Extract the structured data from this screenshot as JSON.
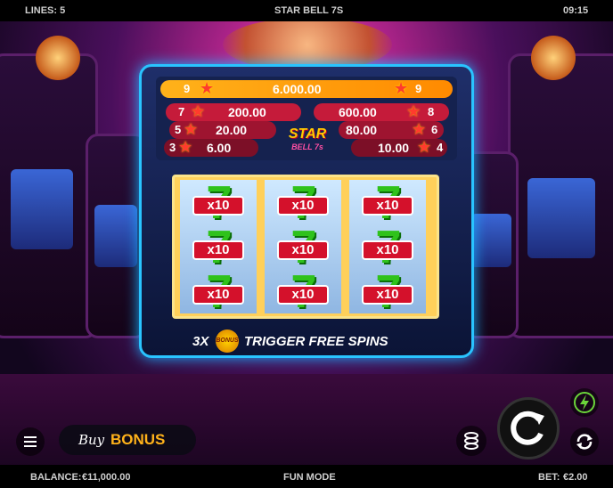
{
  "topbar": {
    "lines": "LINES: 5",
    "title": "STAR BELL 7S",
    "time": "09:15"
  },
  "paytable": {
    "top": {
      "left_count": "9",
      "value": "6.000.00",
      "right_count": "9"
    },
    "rows_left": [
      {
        "count": "7",
        "value": "200.00"
      },
      {
        "count": "5",
        "value": "20.00"
      },
      {
        "count": "3",
        "value": "6.00"
      }
    ],
    "rows_right": [
      {
        "count": "8",
        "value": "600.00"
      },
      {
        "count": "6",
        "value": "80.00"
      },
      {
        "count": "4",
        "value": "10.00"
      }
    ]
  },
  "logo": {
    "line1": "STAR",
    "line2": "BELL 7s"
  },
  "reels": {
    "multiplier": "x10"
  },
  "banner": {
    "count": "3X",
    "bonus_label": "BONUS",
    "text": "TRIGGER FREE SPINS"
  },
  "buy_bonus": {
    "buy": "Buy",
    "bonus": "BONUS"
  },
  "bottombar": {
    "balance_label": "BALANCE:",
    "balance": "€11,000.00",
    "mode": "FUN MODE",
    "bet_label": "BET:",
    "bet": "€2.00"
  },
  "icons": {
    "menu": "menu-icon",
    "stack": "coin-stack-icon",
    "spin": "spin-icon",
    "turbo": "lightning-icon",
    "autoplay": "autoplay-icon"
  },
  "colors": {
    "accent": "#29c4ff",
    "gold": "#ffb21a",
    "red": "#d4112b",
    "green": "#2fc21b"
  }
}
